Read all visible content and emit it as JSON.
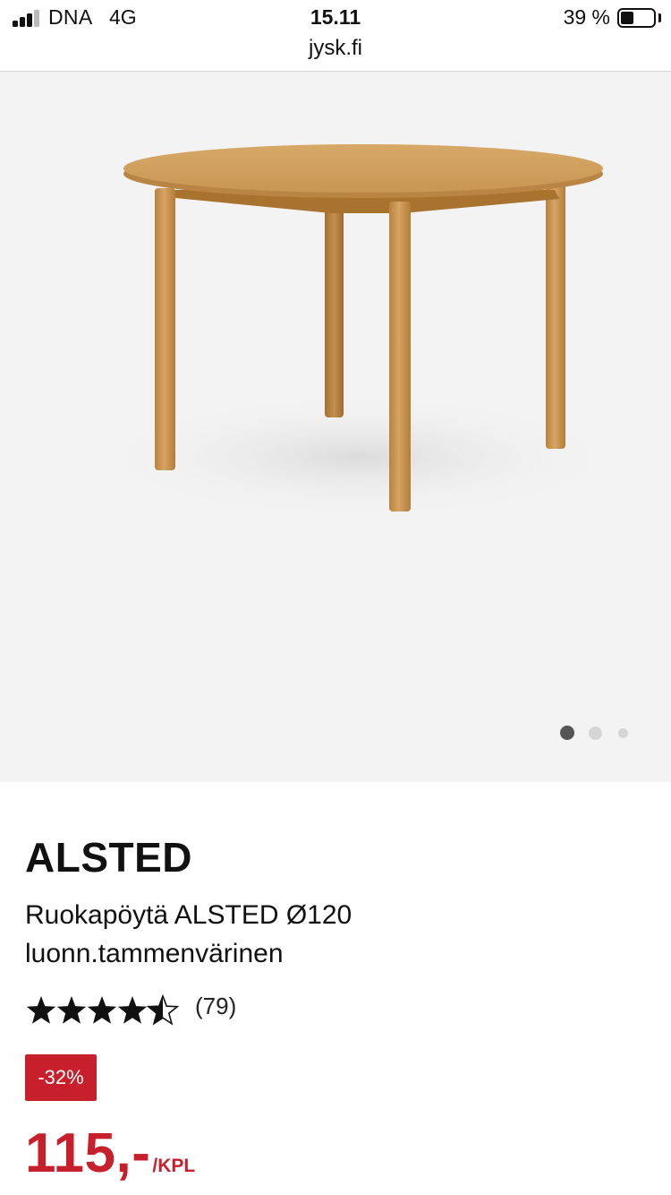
{
  "status_bar": {
    "carrier": "DNA",
    "network": "4G",
    "time": "15.11",
    "url": "jysk.fi",
    "battery_percent_label": "39 %",
    "battery_level": 0.39
  },
  "gallery": {
    "image_count": 3,
    "active_index": 0
  },
  "product": {
    "brand": "ALSTED",
    "description": "Ruokapöytä ALSTED Ø120 luonn.tammenvärinen",
    "rating": 4.5,
    "rating_max": 5,
    "review_count": "(79)",
    "discount_badge": "-32%",
    "price": "115,-",
    "price_unit": "/KPL"
  },
  "colors": {
    "accent_red": "#c7202c",
    "gallery_bg": "#f3f3f3",
    "dot_active": "#555555",
    "dot_inactive": "#d6d6d6"
  }
}
